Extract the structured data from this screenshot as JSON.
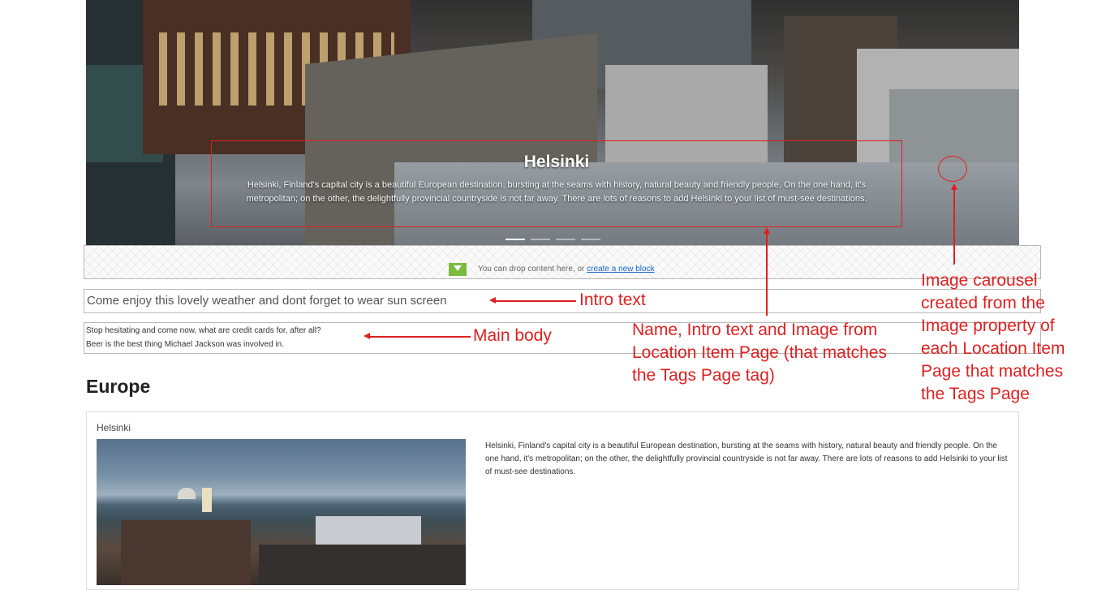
{
  "hero": {
    "title": "Helsinki",
    "text": "Helsinki, Finland's capital city is a beautiful European destination, bursting at the seams with history, natural beauty and friendly people. On the one hand, it's metropolitan; on the other, the delightfully provincial countryside is not far away. There are lots of reasons to add Helsinki to your list of must-see destinations.",
    "slides": 4,
    "active_slide": 1
  },
  "dropzone": {
    "text": "You can drop content here, or",
    "link": "create a new block"
  },
  "intro_text": "Come enjoy this lovely weather and dont forget to wear sun screen",
  "main_body": {
    "line1": "Stop hesitating and come now, what are credit cards for, after all?",
    "line2": "Beer is the best thing Michael Jackson was involved in."
  },
  "section": {
    "heading": "Europe"
  },
  "card": {
    "title": "Helsinki",
    "text": "Helsinki, Finland's capital city is a beautiful European destination, bursting at the seams with history, natural beauty and friendly people. On the one hand, it's metropolitan; on the other, the delightfully provincial countryside is not far away. There are lots of reasons to add Helsinki to your list of must-see destinations."
  },
  "annotations": {
    "intro": "Intro text",
    "body": "Main body",
    "location": "Name, Intro text and Image from Location Item Page (that matches the Tags Page tag)",
    "carousel": "Image carousel created from the Image property of each Location Item Page that matches the Tags Page"
  },
  "colors": {
    "annotation": "#e02020",
    "link": "#1a66cc",
    "drop_icon": "#7cba3d"
  },
  "icons": {
    "drop": "download-arrow-icon"
  }
}
